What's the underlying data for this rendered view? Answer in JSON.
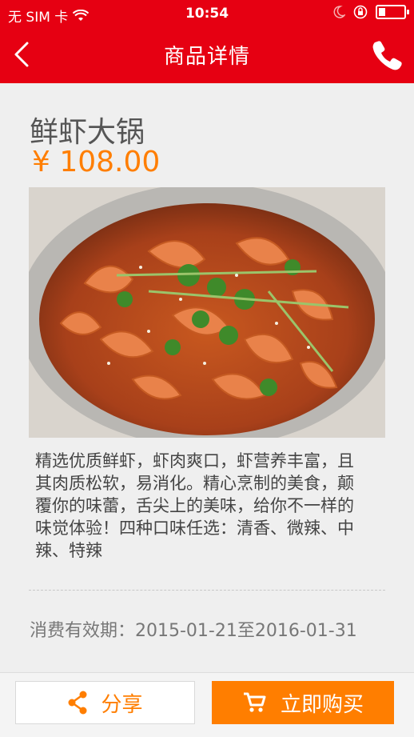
{
  "status_bar": {
    "carrier": "无 SIM 卡",
    "time": "10:54"
  },
  "header": {
    "title": "商品详情"
  },
  "product": {
    "name": "鲜虾大锅",
    "price": "¥ 108.00",
    "description": "精选优质鲜虾，虾肉爽口，虾营养丰富，且其肉质松软，易消化。精心烹制的美食，颠覆你的味蕾，舌尖上的美味，给你不一样的味觉体验！四种口味任选：清香、微辣、中辣、特辣",
    "validity": "消费有效期：2015-01-21至2016-01-31"
  },
  "actions": {
    "share_label": "分享",
    "buy_label": "立即购买"
  },
  "colors": {
    "brand_red": "#e60012",
    "accent_orange": "#ff7e00",
    "background": "#efefef"
  },
  "icons": [
    "wifi-icon",
    "moon-icon",
    "rotation-lock-icon",
    "battery-icon",
    "back-arrow-icon",
    "phone-icon",
    "share-icon",
    "cart-icon"
  ]
}
